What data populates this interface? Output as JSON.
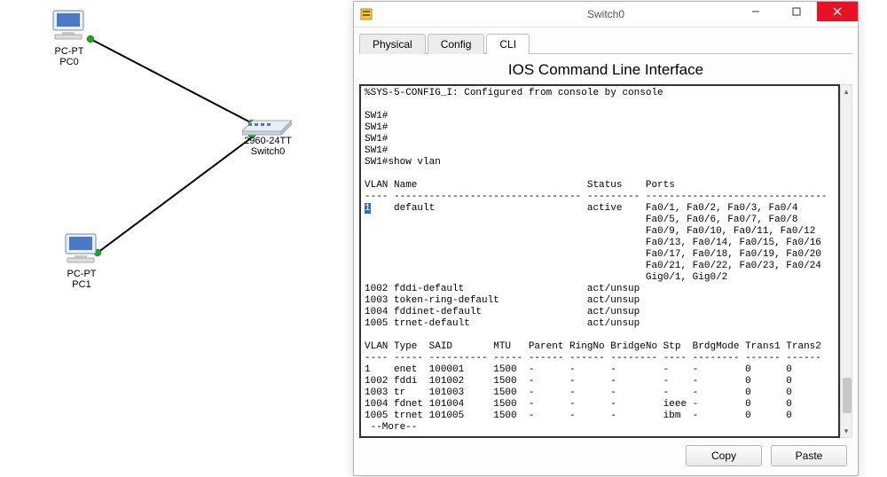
{
  "window": {
    "title": "Switch0",
    "tabs": {
      "0": "Physical",
      "1": "Config",
      "2": "CLI"
    },
    "active_tab_index": 2,
    "cli_heading": "IOS Command Line Interface",
    "buttons": {
      "copy": "Copy",
      "paste": "Paste"
    }
  },
  "terminal": {
    "line_trunc": "%SYS-5-CONFIG_I: Configured from console by console",
    "prompt": "SW1#",
    "cmd": "show vlan",
    "hdr": "VLAN Name                             Status    Ports",
    "rule": "---- -------------------------------- --------- -------------------------------",
    "sel": "1",
    "vlan1_name": "default",
    "vlan1_status": "active",
    "vlan1_ports": [
      "Fa0/1, Fa0/2, Fa0/3, Fa0/4",
      "Fa0/5, Fa0/6, Fa0/7, Fa0/8",
      "Fa0/9, Fa0/10, Fa0/11, Fa0/12",
      "Fa0/13, Fa0/14, Fa0/15, Fa0/16",
      "Fa0/17, Fa0/18, Fa0/19, Fa0/20",
      "Fa0/21, Fa0/22, Fa0/23, Fa0/24",
      "Gig0/1, Gig0/2"
    ],
    "vlan1002": "1002 fddi-default                     act/unsup",
    "vlan1003": "1003 token-ring-default               act/unsup",
    "vlan1004": "1004 fddinet-default                  act/unsup",
    "vlan1005": "1005 trnet-default                    act/unsup",
    "hdr2": "VLAN Type  SAID       MTU   Parent RingNo BridgeNo Stp  BrdgMode Trans1 Trans2",
    "rule2": "---- ----- ---------- ----- ------ ------ -------- ---- -------- ------ ------",
    "row1": "1    enet  100001     1500  -      -      -        -    -        0      0",
    "row2": "1002 fddi  101002     1500  -      -      -        -    -        0      0",
    "row3": "1003 tr    101003     1500  -      -      -        -    -        0      0",
    "row4": "1004 fdnet 101004     1500  -      -      -        ieee -        0      0",
    "row5": "1005 trnet 101005     1500  -      -      -        ibm  -        0      0",
    "more": " --More--"
  },
  "topology": {
    "nodes": {
      "pc0": {
        "type": "PC-PT",
        "name": "PC0"
      },
      "pc1": {
        "type": "PC-PT",
        "name": "PC1"
      },
      "sw": {
        "type": "2960-24TT",
        "name": "Switch0"
      }
    }
  }
}
